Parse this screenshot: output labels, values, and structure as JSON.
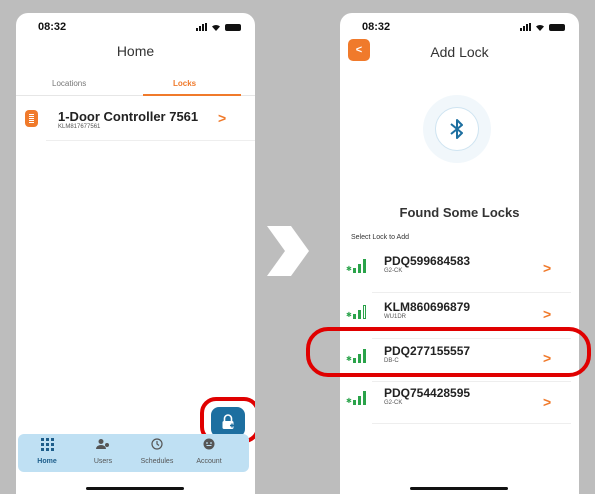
{
  "left": {
    "time": "08:32",
    "title": "Home",
    "tabs": [
      {
        "label": "Locations"
      },
      {
        "label": "Locks"
      }
    ],
    "lock": {
      "name": "1-Door Controller 7561",
      "id": "KLM817677561"
    },
    "nav": [
      {
        "label": "Home",
        "icon": "grid-icon"
      },
      {
        "label": "Users",
        "icon": "users-icon"
      },
      {
        "label": "Schedules",
        "icon": "clock-icon"
      },
      {
        "label": "Account",
        "icon": "account-icon"
      }
    ],
    "fab_icon": "add-lock-icon"
  },
  "right": {
    "time": "08:32",
    "title": "Add Lock",
    "found_title": "Found Some Locks",
    "select_label": "Select Lock to Add",
    "locks": [
      {
        "name": "PDQ599684583",
        "type": "G2-CK"
      },
      {
        "name": "KLM860696879",
        "type": "WU1DR"
      },
      {
        "name": "PDQ277155557",
        "type": "DB-C"
      },
      {
        "name": "PDQ754428595",
        "type": "G2-CK"
      }
    ]
  },
  "colors": {
    "accent": "#f07a2b",
    "primary": "#1d6fa0",
    "signal": "#2aa34a",
    "highlight": "#e00000",
    "nav_bg": "#bfe0f3"
  }
}
